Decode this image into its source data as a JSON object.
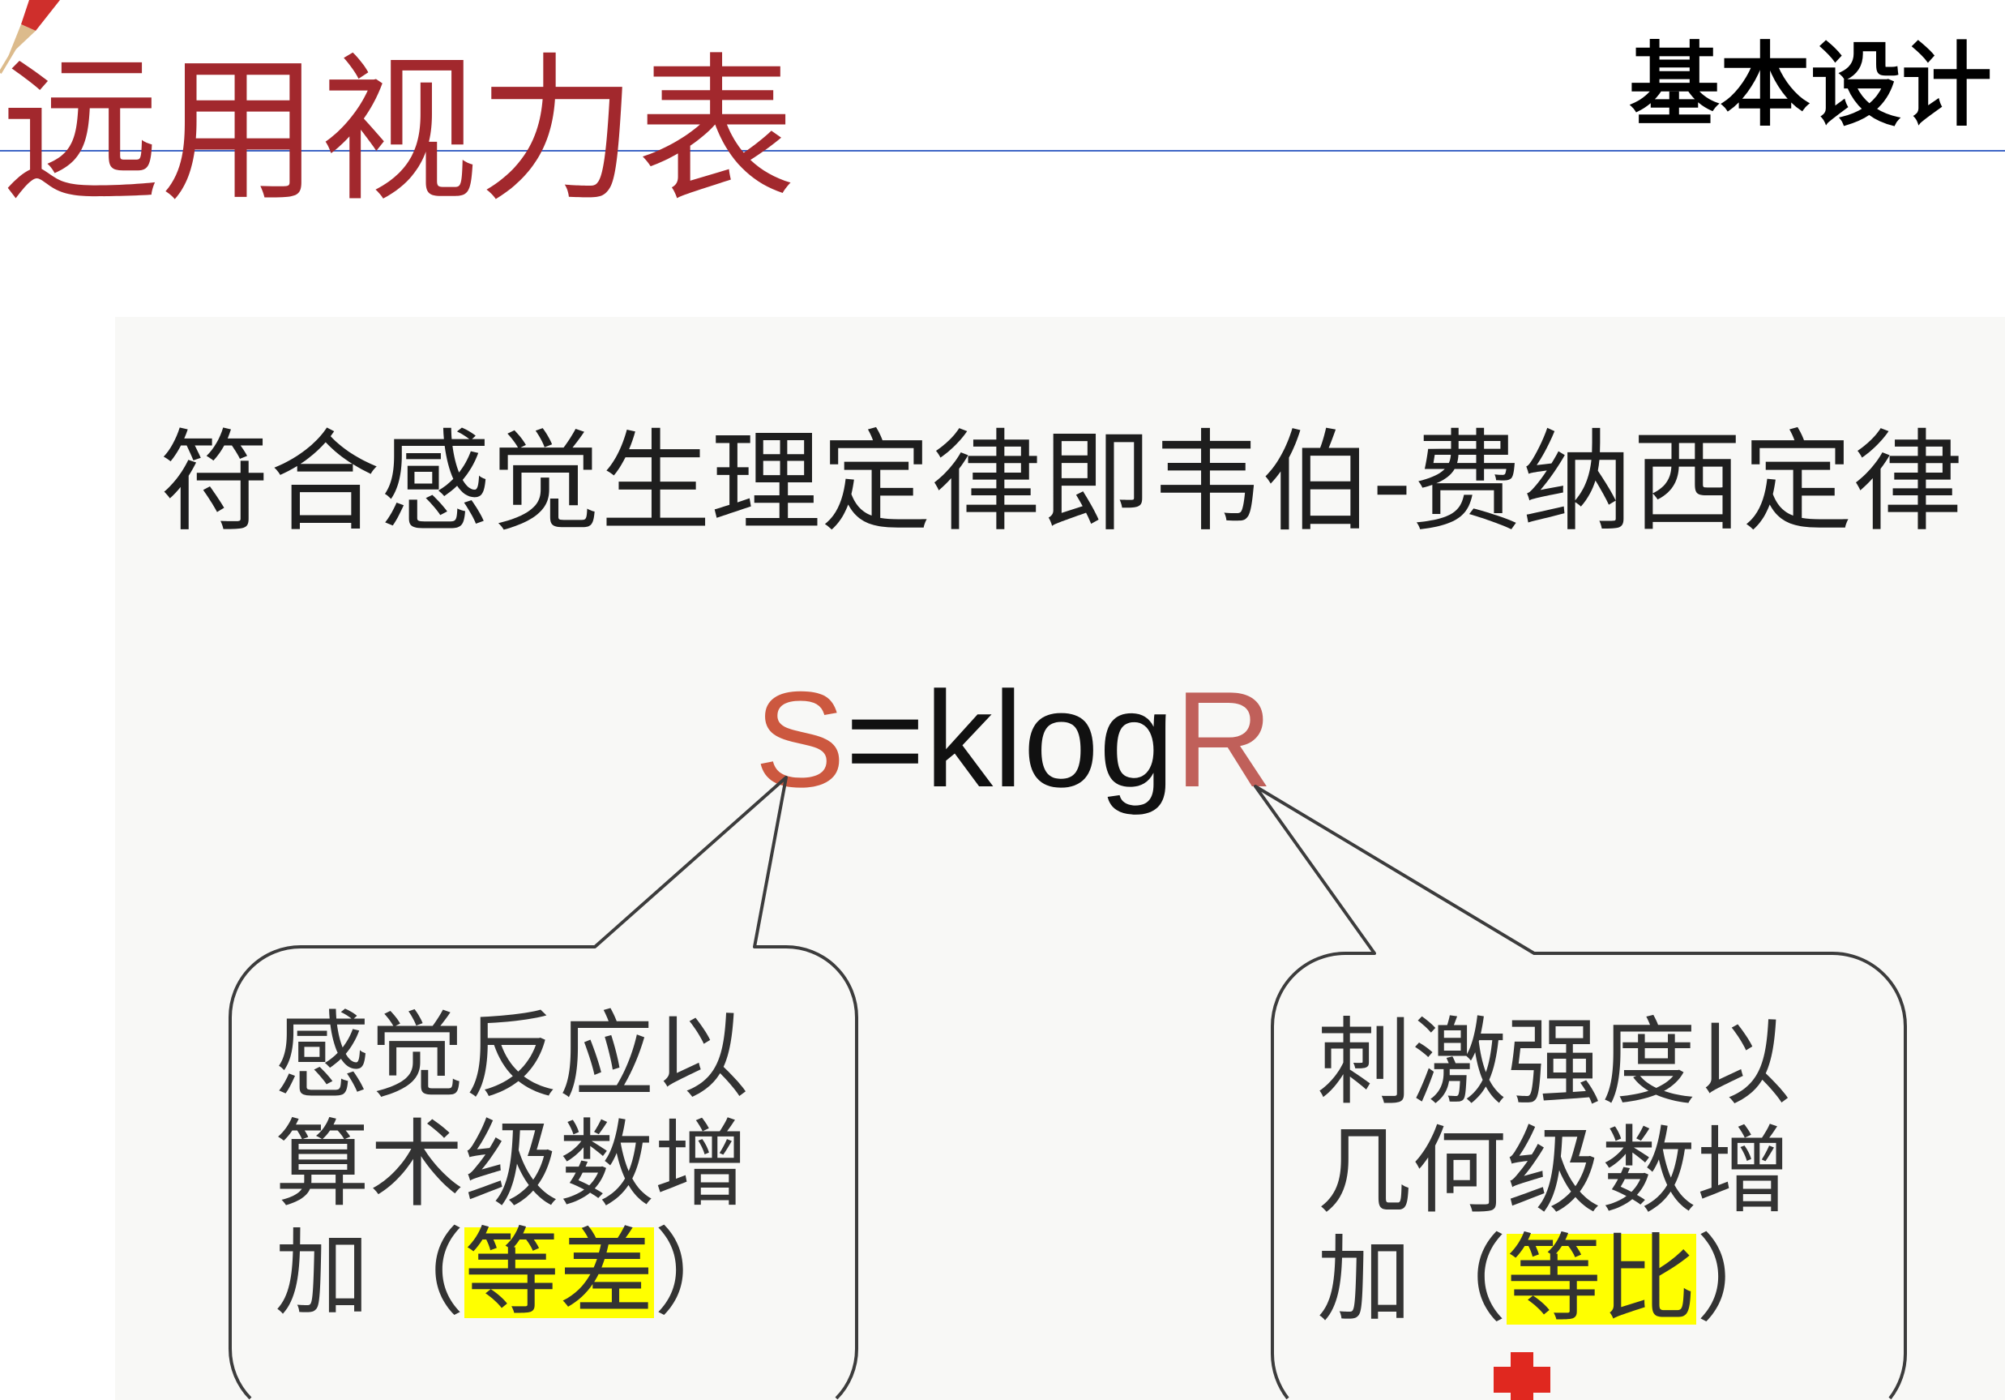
{
  "slide": {
    "title": "远用视力表",
    "section_label": "基本设计"
  },
  "figure": {
    "heading": "符合感觉生理定律即韦伯-费纳西定律",
    "formula": {
      "s": "S",
      "middle": "=klog",
      "r": "R"
    },
    "left_bubble": {
      "lines": [
        "感觉反应以",
        "算术级数增"
      ],
      "last_line": {
        "prefix": "加（",
        "highlight": "等差",
        "suffix": "）"
      }
    },
    "right_bubble": {
      "lines": [
        "刺激强度以",
        "几何级数增"
      ],
      "last_line": {
        "prefix": "加（",
        "highlight": "等比",
        "suffix": "）"
      }
    }
  },
  "icons": {
    "corner": "pen-icon",
    "bottom": "plus-icon"
  },
  "colors": {
    "title": "#a2282d",
    "rule": "#3f66c6",
    "panel": "#f8f8f6",
    "formula_s": "#cc583f",
    "formula_r": "#c0605a",
    "highlight": "#ffff00",
    "bubble": "#3c3c3c",
    "cross": "#e0281f",
    "pen_body": "#cf2f2c",
    "pen_tip": "#dcbb8c"
  }
}
